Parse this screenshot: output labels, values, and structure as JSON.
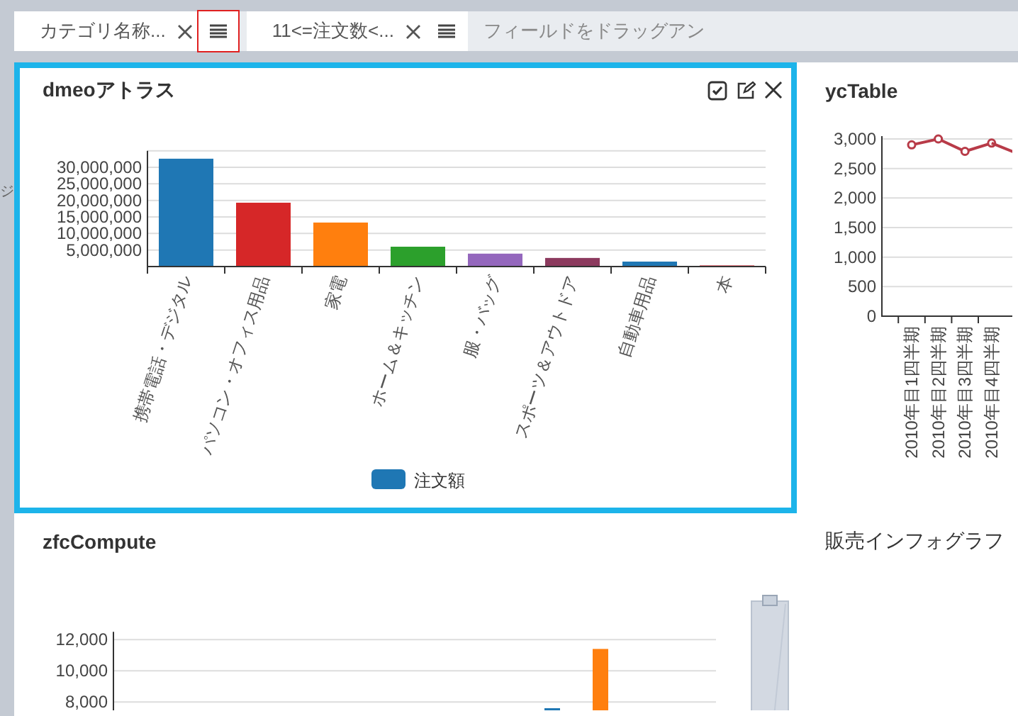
{
  "filter_bar": {
    "filters": [
      {
        "label": "カテゴリ名称...",
        "menu_focused": true
      },
      {
        "label": "11<=注文数<...",
        "menu_focused": false
      }
    ],
    "drop_hint": "フィールドをドラッグアン"
  },
  "side_strip": {
    "text": "ジ"
  },
  "panels": [
    {
      "title": "dmeoアトラス",
      "selected": true,
      "chart_data": {
        "type": "bar",
        "categories": [
          "携帯電話・デジタル",
          "パソコン・オフィス用品",
          "家電",
          "ホーム＆キッチン",
          "服・バッグ",
          "スポーツ＆アウトドア",
          "自動車用品",
          "本"
        ],
        "series": [
          {
            "name": "注文額",
            "color": "#1f77b4",
            "colors": [
              "#1f77b4",
              "#d62728",
              "#ff7f0e",
              "#2ca02c",
              "#9467bd",
              "#8c3a5e",
              "#1f77b4",
              "#e06c75"
            ],
            "values": [
              32600000,
              19300000,
              13300000,
              6000000,
              3900000,
              2600000,
              1500000,
              400000
            ]
          }
        ],
        "ylim": [
          0,
          35000000
        ],
        "grid": true,
        "yticks": [
          {
            "value": 5000000,
            "label": "5,000,000"
          },
          {
            "value": 10000000,
            "label": "10,000,000"
          },
          {
            "value": 15000000,
            "label": "15,000,000"
          },
          {
            "value": 20000000,
            "label": "20,000,000"
          },
          {
            "value": 25000000,
            "label": "25,000,000"
          },
          {
            "value": 30000000,
            "label": "30,000,000"
          }
        ]
      }
    },
    {
      "title": "ycTable",
      "selected": false,
      "chart_data": {
        "type": "line",
        "categories": [
          "2010年目1四半期",
          "2010年目2四半期",
          "2010年目3四半期",
          "2010年目4四半期"
        ],
        "series": [
          {
            "color": "#b83b48",
            "marker": "circle",
            "values": [
              2900,
              3000,
              2790,
              2930
            ]
          }
        ],
        "ylim": [
          0,
          3000
        ],
        "grid": true,
        "yticks": [
          {
            "value": 0,
            "label": "0"
          },
          {
            "value": 500,
            "label": "500"
          },
          {
            "value": 1000,
            "label": "1,000"
          },
          {
            "value": 1500,
            "label": "1,500"
          },
          {
            "value": 2000,
            "label": "2,000"
          },
          {
            "value": 2500,
            "label": "2,500"
          },
          {
            "value": 3000,
            "label": "3,000"
          }
        ]
      }
    },
    {
      "title": "zfcCompute",
      "selected": false,
      "chart_data": {
        "type": "bar",
        "series": [
          {
            "color": "#1f77b4",
            "values": [
              7600
            ]
          },
          {
            "color": "#ff7f0e",
            "values": [
              11400
            ]
          }
        ],
        "ylim": [
          7100,
          12500
        ],
        "grid": true,
        "yticks": [
          {
            "value": 8000,
            "label": "8,000"
          },
          {
            "value": 10000,
            "label": "10,000"
          },
          {
            "value": 12000,
            "label": "12,000"
          }
        ]
      }
    },
    {
      "title": "販売インフォグラフ",
      "selected": false
    }
  ]
}
